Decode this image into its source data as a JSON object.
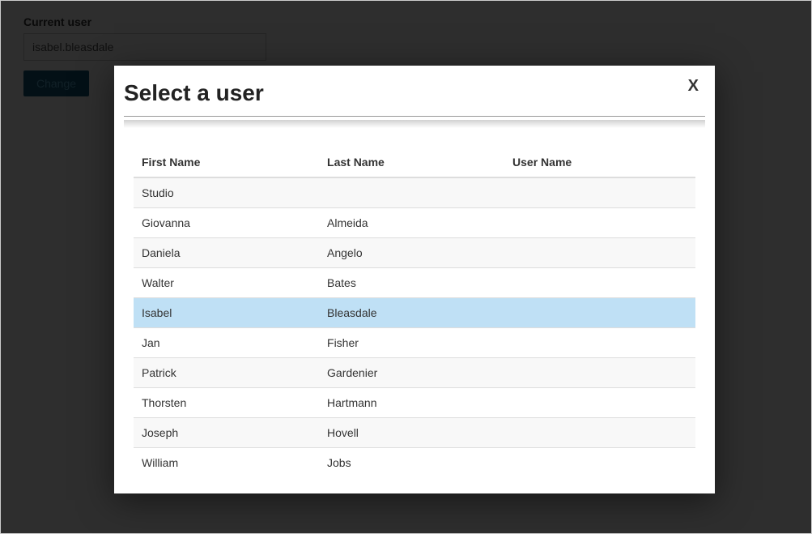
{
  "page": {
    "current_user_label": "Current user",
    "current_user_value": "isabel.bleasdale",
    "change_button_label": "Change"
  },
  "modal": {
    "title": "Select a user",
    "close_label": "X",
    "columns": {
      "first_name": "First Name",
      "last_name": "Last Name",
      "user_name": "User Name"
    },
    "users": [
      {
        "first": "Studio",
        "last": "",
        "user": "",
        "selected": false
      },
      {
        "first": "Giovanna",
        "last": "Almeida",
        "user": "",
        "selected": false
      },
      {
        "first": "Daniela",
        "last": "Angelo",
        "user": "",
        "selected": false
      },
      {
        "first": "Walter",
        "last": "Bates",
        "user": "",
        "selected": false
      },
      {
        "first": "Isabel",
        "last": "Bleasdale",
        "user": "",
        "selected": true
      },
      {
        "first": "Jan",
        "last": "Fisher",
        "user": "",
        "selected": false
      },
      {
        "first": "Patrick",
        "last": "Gardenier",
        "user": "",
        "selected": false
      },
      {
        "first": "Thorsten",
        "last": "Hartmann",
        "user": "",
        "selected": false
      },
      {
        "first": "Joseph",
        "last": "Hovell",
        "user": "",
        "selected": false
      },
      {
        "first": "William",
        "last": "Jobs",
        "user": "",
        "selected": false
      }
    ]
  }
}
